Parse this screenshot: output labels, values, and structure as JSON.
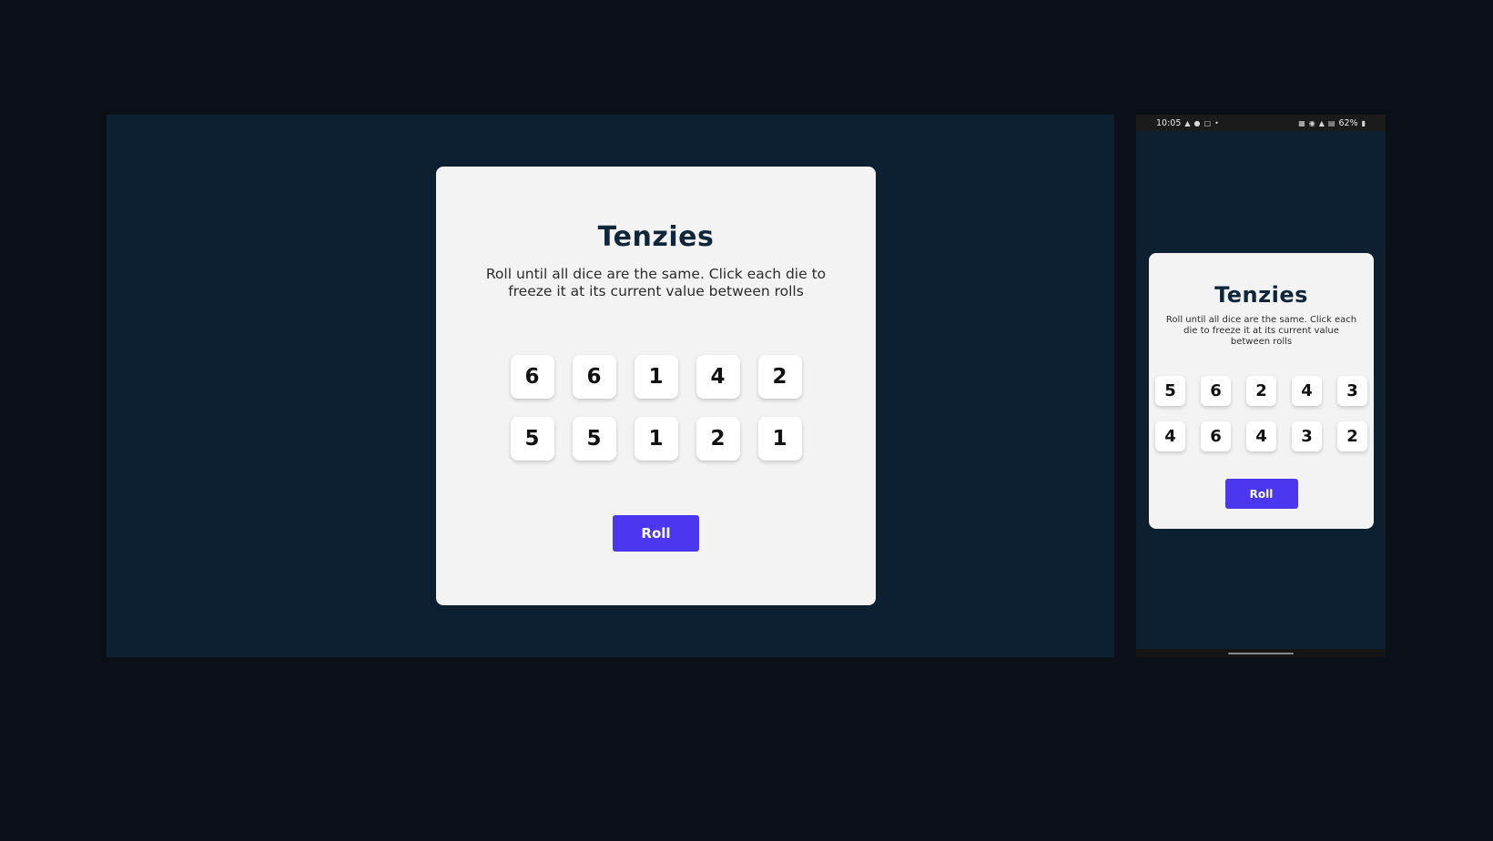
{
  "desktop": {
    "title": "Tenzies",
    "description": "Roll until all dice are the same. Click each die to freeze it at its current value between rolls",
    "dice": [
      "6",
      "6",
      "1",
      "4",
      "2",
      "5",
      "5",
      "1",
      "2",
      "1"
    ],
    "roll_label": "Roll"
  },
  "mobile": {
    "status_bar": {
      "time": "10:05",
      "battery": "62%"
    },
    "title": "Tenzies",
    "description": "Roll until all dice are the same. Click each die to freeze it at its current value between rolls",
    "dice": [
      "5",
      "6",
      "2",
      "4",
      "3",
      "4",
      "6",
      "4",
      "3",
      "2"
    ],
    "roll_label": "Roll"
  },
  "colors": {
    "page_background": "#0b0f17",
    "app_background": "#0c2031",
    "card_background": "#f3f3f4",
    "title_color": "#10263a",
    "button_accent": "#4b37f0",
    "die_background": "#ffffff"
  }
}
